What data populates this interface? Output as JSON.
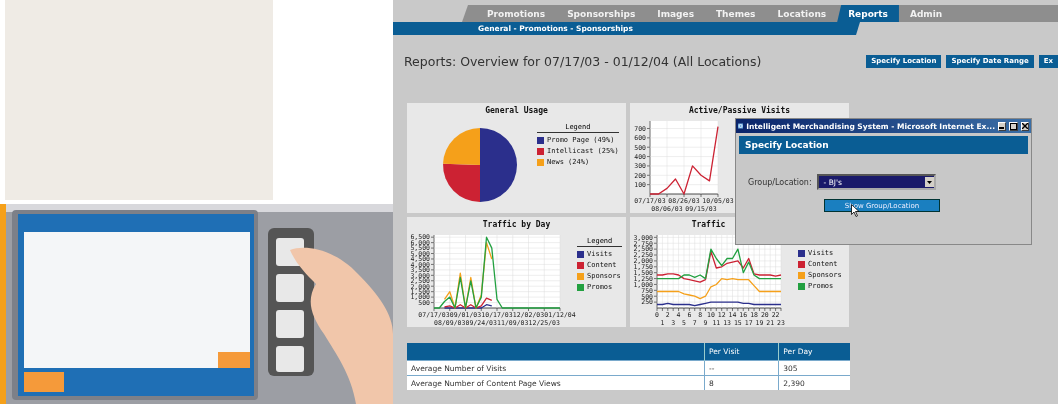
{
  "nav": {
    "tabs": [
      {
        "label": "Promotions",
        "selected": false
      },
      {
        "label": "Sponsorships",
        "selected": false
      },
      {
        "label": "Images",
        "selected": false
      },
      {
        "label": "Themes",
        "selected": false
      },
      {
        "label": "Locations",
        "selected": false
      },
      {
        "label": "Reports",
        "selected": true
      },
      {
        "label": "Admin",
        "selected": false
      }
    ],
    "subnav": "General - Promotions - Sponsorships"
  },
  "page": {
    "title": "Reports: Overview for 07/17/03 - 01/12/04 (All Locations)",
    "buttons": [
      "Specify Location",
      "Specify Date Range",
      "Ex"
    ]
  },
  "charts": [
    {
      "title": "General Usage",
      "legend_title": "Legend",
      "chart_data": {
        "type": "pie",
        "legend": "right",
        "categories": [
          "Promo Page (49%)",
          "Intellicast (25%)",
          "News (24%)"
        ],
        "series": [
          {
            "colors": [
              "#2b2f8c",
              "#cc2233",
              "#f5a01a"
            ],
            "values": [
              49,
              25,
              24
            ]
          }
        ]
      }
    },
    {
      "title": "Active/Passive Visits",
      "chart_data": {
        "type": "line",
        "grid": true,
        "ylim": [
          0,
          780
        ],
        "categories": [
          "07/17/03",
          null,
          "08/06/03",
          null,
          "08/26/03",
          null,
          "09/15/03",
          null,
          "10/05/03"
        ],
        "yticks": [
          {
            "value": 100,
            "label": "100"
          },
          {
            "value": 200,
            "label": "200"
          },
          {
            "value": 300,
            "label": "300"
          },
          {
            "value": 400,
            "label": "400"
          },
          {
            "value": 500,
            "label": "500"
          },
          {
            "value": 600,
            "label": "600"
          },
          {
            "value": 700,
            "label": "700"
          }
        ],
        "series": [
          {
            "color": "#cc2233",
            "values": [
              0,
              0,
              60,
              160,
              0,
              300,
              200,
              140,
              720
            ]
          }
        ]
      }
    },
    {
      "title": "Traffic by Day",
      "legend_title": "Legend",
      "chart_data": {
        "type": "line",
        "legend": "right",
        "grid": true,
        "ylim": [
          0,
          6700
        ],
        "categories": [
          "07/17/03",
          null,
          null,
          "08/09/03",
          null,
          null,
          "09/01/03",
          null,
          null,
          "09/24/03",
          null,
          null,
          "10/17/03",
          null,
          null,
          "11/09/03",
          null,
          null,
          "12/02/03",
          null,
          null,
          "12/25/03",
          null,
          null,
          "01/12/04"
        ],
        "yticks": [
          {
            "value": 500,
            "label": "500"
          },
          {
            "value": 1000,
            "label": "1,000"
          },
          {
            "value": 1500,
            "label": "1,500"
          },
          {
            "value": 2000,
            "label": "2,000"
          },
          {
            "value": 2500,
            "label": "2,500"
          },
          {
            "value": 3000,
            "label": "3,000"
          },
          {
            "value": 3500,
            "label": "3,500"
          },
          {
            "value": 4000,
            "label": "4,000"
          },
          {
            "value": 4500,
            "label": "4,500"
          },
          {
            "value": 5000,
            "label": "5,000"
          },
          {
            "value": 5500,
            "label": "5,500"
          },
          {
            "value": 6000,
            "label": "6,000"
          },
          {
            "value": 6500,
            "label": "6,500"
          }
        ],
        "series": [
          {
            "name": "Visits",
            "color": "#2b2f8c",
            "values": [
              null,
              null,
              0,
              0,
              0,
              0,
              0,
              0,
              0,
              0,
              300,
              200,
              null,
              null,
              null,
              null,
              null,
              null,
              null,
              null,
              null,
              null,
              null,
              null,
              null
            ]
          },
          {
            "name": "Content",
            "color": "#cc2233",
            "values": [
              null,
              null,
              100,
              200,
              0,
              300,
              0,
              300,
              0,
              200,
              900,
              700,
              null,
              null,
              null,
              null,
              null,
              null,
              null,
              null,
              null,
              null,
              null,
              null,
              null
            ]
          },
          {
            "name": "Sponsors",
            "color": "#f5a01a",
            "values": [
              null,
              null,
              800,
              1500,
              0,
              3200,
              0,
              2800,
              0,
              1200,
              6000,
              4500,
              null,
              null,
              null,
              null,
              null,
              null,
              null,
              null,
              null,
              null,
              null,
              null,
              null
            ]
          },
          {
            "name": "Promos",
            "color": "#22a040",
            "values": [
              0,
              0,
              600,
              1000,
              0,
              2800,
              0,
              2500,
              0,
              1000,
              6500,
              5500,
              800,
              0,
              0,
              0,
              0,
              0,
              0,
              0,
              0,
              0,
              0,
              0,
              0
            ]
          }
        ]
      }
    },
    {
      "title": "Traffic",
      "chart_data": {
        "type": "line",
        "legend": "right",
        "grid": true,
        "categories": [
          "0",
          "1",
          "2",
          "3",
          "4",
          "5",
          "6",
          "7",
          "8",
          "9",
          "10",
          "11",
          "12",
          "13",
          "14",
          "15",
          "16",
          "17",
          "18",
          "19",
          "20",
          "21",
          "22",
          "23"
        ],
        "ylim": [
          0,
          3100
        ],
        "yticks": [
          {
            "value": 250,
            "label": "250"
          },
          {
            "value": 500,
            "label": "500"
          },
          {
            "value": 750,
            "label": "750"
          },
          {
            "value": 1000,
            "label": "1,000"
          },
          {
            "value": 1250,
            "label": "1,250"
          },
          {
            "value": 1500,
            "label": "1,500"
          },
          {
            "value": 1750,
            "label": "1,750"
          },
          {
            "value": 2000,
            "label": "2,000"
          },
          {
            "value": 2250,
            "label": "2,250"
          },
          {
            "value": 2500,
            "label": "2,500"
          },
          {
            "value": 2750,
            "label": "2,750"
          },
          {
            "value": 3000,
            "label": "3,000"
          }
        ],
        "series": [
          {
            "name": "Visits",
            "color": "#2b2f8c",
            "values": [
              150,
              150,
              200,
              150,
              150,
              150,
              150,
              100,
              150,
              200,
              250,
              250,
              250,
              250,
              250,
              250,
              200,
              200,
              150,
              150,
              150,
              150,
              150,
              150
            ]
          },
          {
            "name": "Content",
            "color": "#cc2233",
            "values": [
              1400,
              1400,
              1450,
              1450,
              1400,
              1250,
              1200,
              1150,
              1100,
              1200,
              2400,
              1700,
              1750,
              1900,
              1950,
              2000,
              1700,
              2100,
              1450,
              1400,
              1400,
              1400,
              1350,
              1400
            ]
          },
          {
            "name": "Sponsors",
            "color": "#f5a01a",
            "values": [
              700,
              700,
              700,
              700,
              700,
              600,
              550,
              500,
              400,
              500,
              900,
              1000,
              1250,
              1200,
              1250,
              1200,
              1200,
              1200,
              950,
              700,
              700,
              700,
              700,
              700
            ]
          },
          {
            "name": "Promos",
            "color": "#22a040",
            "values": [
              1250,
              1250,
              1250,
              1250,
              1250,
              1400,
              1400,
              1300,
              1400,
              1250,
              2500,
              2100,
              1800,
              2100,
              2100,
              2500,
              1500,
              1950,
              1400,
              1250,
              1250,
              1250,
              1250,
              1250
            ]
          }
        ]
      }
    }
  ],
  "table": {
    "columns": [
      "",
      "Per Visit",
      "Per Day"
    ],
    "rows": [
      [
        "Average Number of Visits",
        "--",
        "305"
      ],
      [
        "Average Number of Content Page Views",
        "8",
        "2,390"
      ]
    ]
  },
  "popup": {
    "title": "Intelligent Merchandising System - Microsoft Internet Ex...",
    "header": "Specify Location",
    "field_label": "Group/Location:",
    "select_value": "- BJ's",
    "button": "Show Group/Location"
  }
}
